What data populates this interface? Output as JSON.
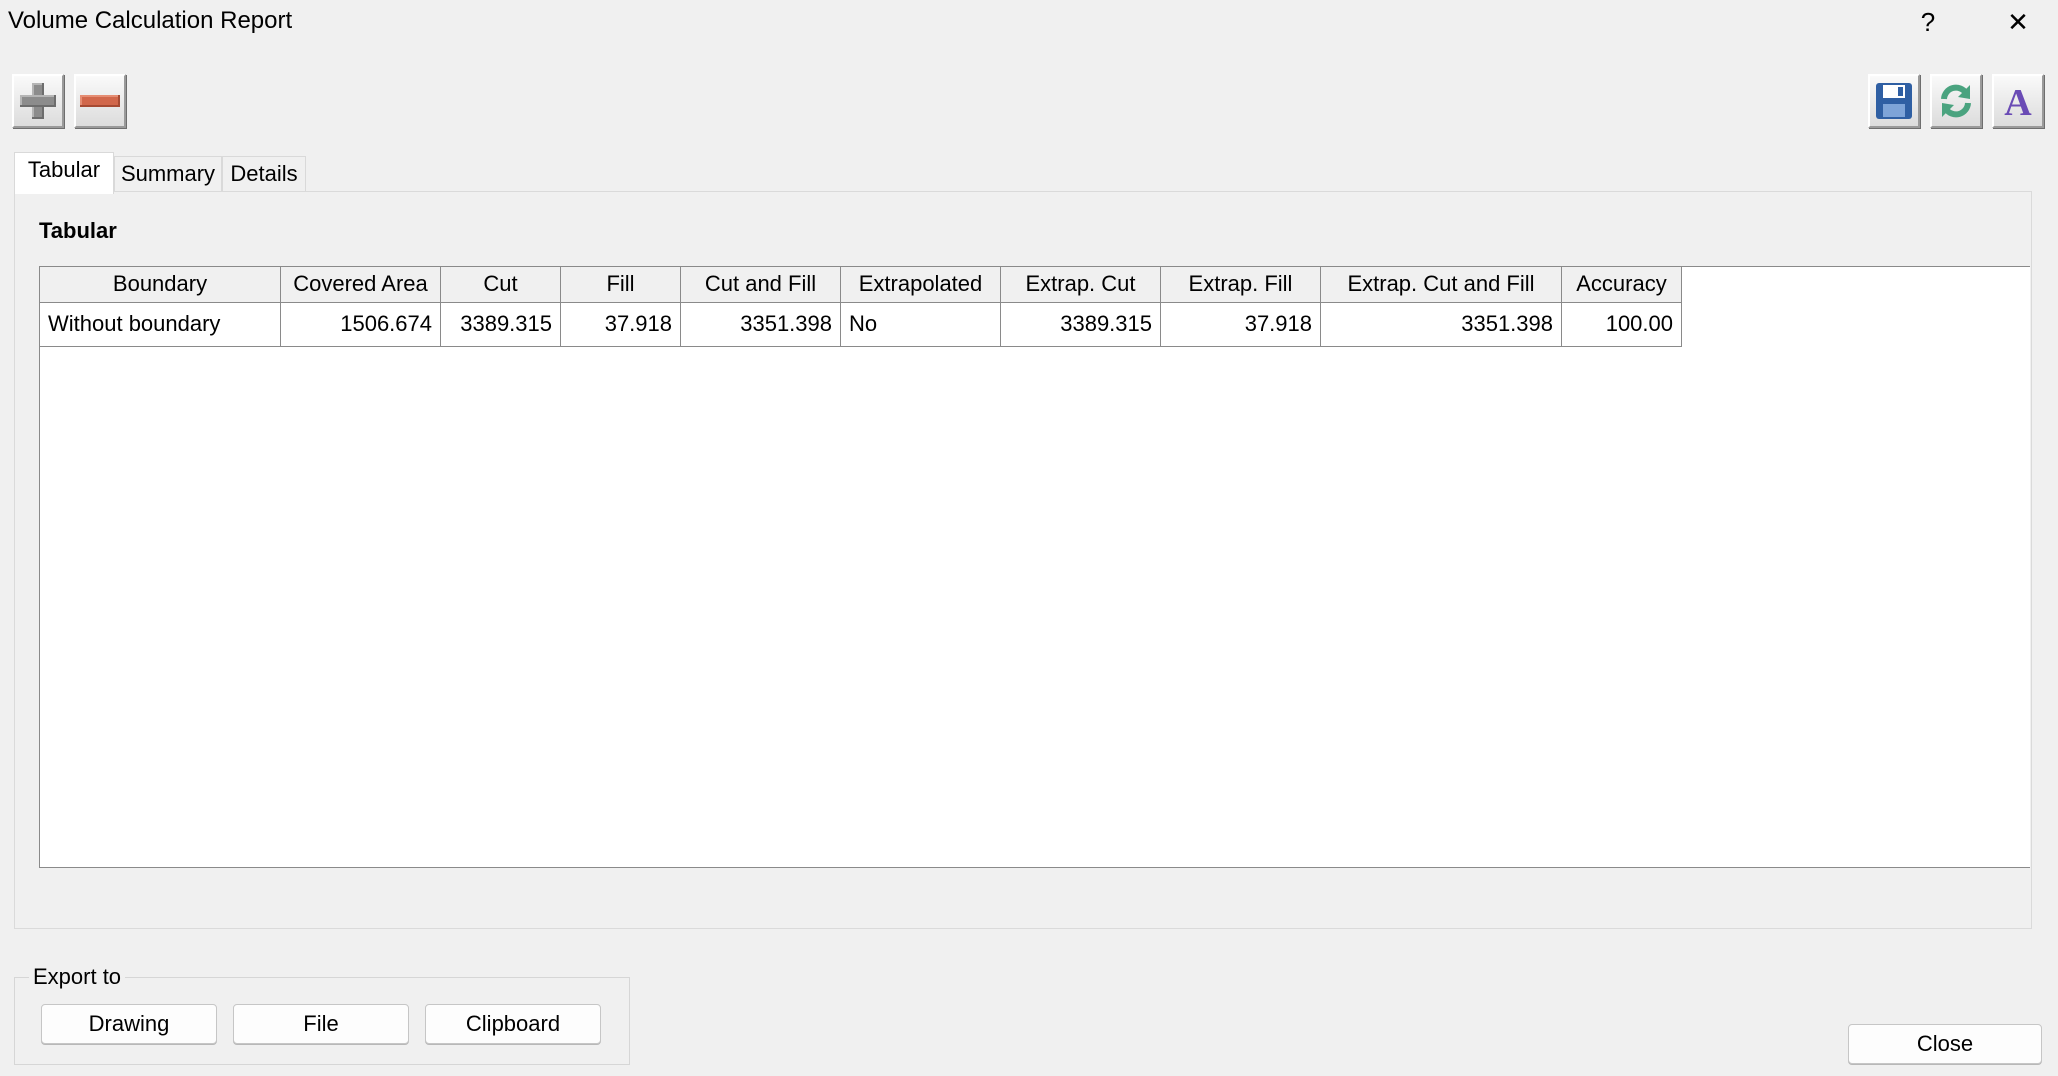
{
  "window": {
    "title": "Volume Calculation Report",
    "help_label": "?",
    "close_label": "✕"
  },
  "toolbar": {
    "add_icon": "plus-icon",
    "remove_icon": "minus-icon",
    "save_icon": "floppy-disk-icon",
    "refresh_icon": "refresh-icon",
    "font_icon": "font-icon",
    "font_glyph": "A"
  },
  "tabs": [
    {
      "label": "Tabular",
      "active": true
    },
    {
      "label": "Summary",
      "active": false
    },
    {
      "label": "Details",
      "active": false
    }
  ],
  "panel": {
    "heading": "Tabular"
  },
  "table": {
    "columns": [
      "Boundary",
      "Covered Area",
      "Cut",
      "Fill",
      "Cut and Fill",
      "Extrapolated",
      "Extrap. Cut",
      "Extrap. Fill",
      "Extrap. Cut and Fill",
      "Accuracy"
    ],
    "rows": [
      [
        "Without boundary",
        "1506.674",
        "3389.315",
        "37.918",
        "3351.398",
        "No",
        "3389.315",
        "37.918",
        "3351.398",
        "100.00"
      ]
    ]
  },
  "export": {
    "legend": "Export to",
    "drawing_label": "Drawing",
    "file_label": "File",
    "clipboard_label": "Clipboard"
  },
  "footer": {
    "close_label": "Close"
  },
  "colors": {
    "background": "#f0f0f0",
    "remove_accent": "#d1674b",
    "save_accent": "#2f5fa3",
    "refresh_accent": "#4aa37f",
    "font_accent": "#6a4bb5"
  }
}
